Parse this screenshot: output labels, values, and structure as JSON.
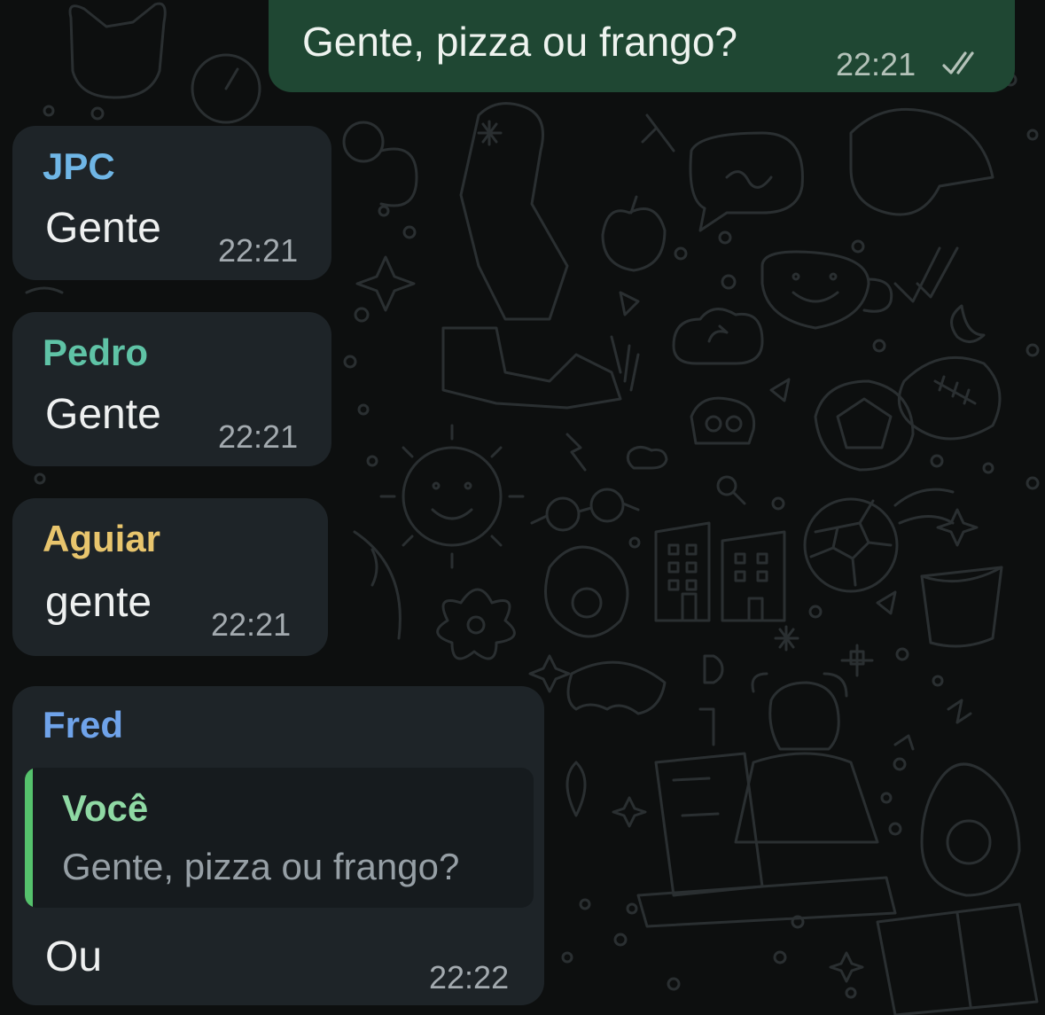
{
  "colors": {
    "incoming_bubble": "#1e2428",
    "outgoing_bubble": "#1f4733",
    "quote_accent": "#55c26c"
  },
  "messages": [
    {
      "direction": "outgoing",
      "text": "Gente, pizza ou frango?",
      "time": "22:21",
      "status_icon": "double-check-icon"
    },
    {
      "direction": "incoming",
      "sender": "JPC",
      "sender_color": "#6fb6e6",
      "text": "Gente",
      "time": "22:21"
    },
    {
      "direction": "incoming",
      "sender": "Pedro",
      "sender_color": "#5fc3a6",
      "text": "Gente",
      "time": "22:21"
    },
    {
      "direction": "incoming",
      "sender": "Aguiar",
      "sender_color": "#e8c56d",
      "text": "gente",
      "time": "22:21"
    },
    {
      "direction": "incoming",
      "sender": "Fred",
      "sender_color": "#6fa3ea",
      "text": "Ou",
      "time": "22:22",
      "reply": {
        "author": "Você",
        "author_color": "#8fd9a4",
        "text": "Gente, pizza ou frango?"
      }
    }
  ]
}
